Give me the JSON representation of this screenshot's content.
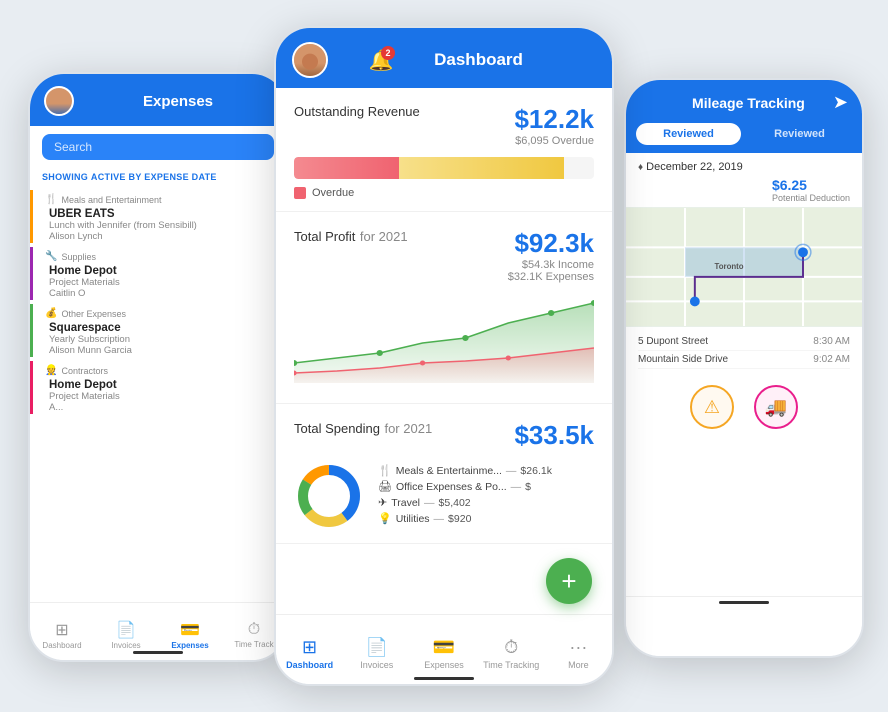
{
  "background": "#e8edf2",
  "center": {
    "header": {
      "title": "Dashboard",
      "notif_count": "2"
    },
    "sections": {
      "revenue": {
        "title": "Outstanding Revenue",
        "amount": "$12.2k",
        "overdue_amount": "$6,095 Overdue",
        "overdue_label": "Overdue",
        "bar_pink_pct": 35,
        "bar_yellow_pct": 55
      },
      "profit": {
        "title": "Total Profit",
        "year": "for 2021",
        "amount": "$92.3k",
        "income": "$54.3k Income",
        "expenses": "$32.1K Expenses"
      },
      "spending": {
        "title": "Total Spending",
        "year": "for 2021",
        "amount": "$33.5k",
        "items": [
          {
            "icon": "🍴",
            "label": "Meals & Entertainme...",
            "amount": "$26.1k"
          },
          {
            "icon": "🖨",
            "label": "Office Expenses & Po...",
            "amount": "$"
          },
          {
            "icon": "✈",
            "label": "Travel",
            "amount": "$5,402"
          },
          {
            "icon": "💡",
            "label": "Utilities",
            "amount": "$920"
          }
        ]
      }
    },
    "fab_label": "+",
    "bottom_nav": [
      {
        "icon": "⊞",
        "label": "Dashboard",
        "active": true
      },
      {
        "icon": "📄",
        "label": "Invoices",
        "active": false
      },
      {
        "icon": "💳",
        "label": "Expenses",
        "active": false
      },
      {
        "icon": "⏱",
        "label": "Time Tracking",
        "active": false
      },
      {
        "icon": "···",
        "label": "More",
        "active": false
      }
    ]
  },
  "left": {
    "header": {
      "title": "Expenses"
    },
    "search_placeholder": "Search",
    "showing_label": "SHOWING",
    "showing_filter": "ACTIVE BY EXPENSE DATE",
    "groups": [
      {
        "type": "meals",
        "icon": "🍴",
        "name": "Meals and Entertainment",
        "items": [
          {
            "name": "UBER EATS",
            "sub1": "Lunch with Jennifer (from Sensibill)",
            "sub2": "Alison Lynch"
          }
        ]
      },
      {
        "type": "supplies",
        "icon": "🔧",
        "name": "Supplies",
        "items": [
          {
            "name": "Home Depot",
            "sub1": "Project Materials",
            "sub2": "Caitlin O"
          }
        ]
      },
      {
        "type": "other",
        "icon": "💰",
        "name": "Other Expenses",
        "items": [
          {
            "name": "Squarespace",
            "sub1": "Yearly Subscription",
            "sub2": "Alison Munn Garcia"
          }
        ]
      },
      {
        "type": "contractors",
        "icon": "👷",
        "name": "Contractors",
        "items": [
          {
            "name": "Home Depot",
            "sub1": "Project Materials",
            "sub2": "A..."
          }
        ]
      }
    ],
    "bottom_nav": [
      {
        "icon": "⊞",
        "label": "Dashboard",
        "active": false
      },
      {
        "icon": "📄",
        "label": "Invoices",
        "active": false
      },
      {
        "icon": "💳",
        "label": "Expenses",
        "active": true
      },
      {
        "icon": "⏱",
        "label": "Time Track",
        "active": false
      }
    ]
  },
  "right": {
    "header": {
      "title": "Mileage Tracking"
    },
    "tabs": [
      {
        "label": "Reviewed",
        "active": true
      },
      {
        "label": "Reviewed",
        "active": false
      }
    ],
    "date": "December 22, 2019",
    "amount": "$6.25",
    "potential_deduction": "Potential Deduction",
    "addresses": [
      {
        "street": "5 Dupont Street",
        "time": "8:30 AM"
      },
      {
        "street": "Mountain Side Drive",
        "time": "9:02 AM"
      }
    ],
    "icons": [
      {
        "type": "warning",
        "color": "yellow"
      },
      {
        "type": "truck",
        "color": "pink"
      }
    ]
  }
}
